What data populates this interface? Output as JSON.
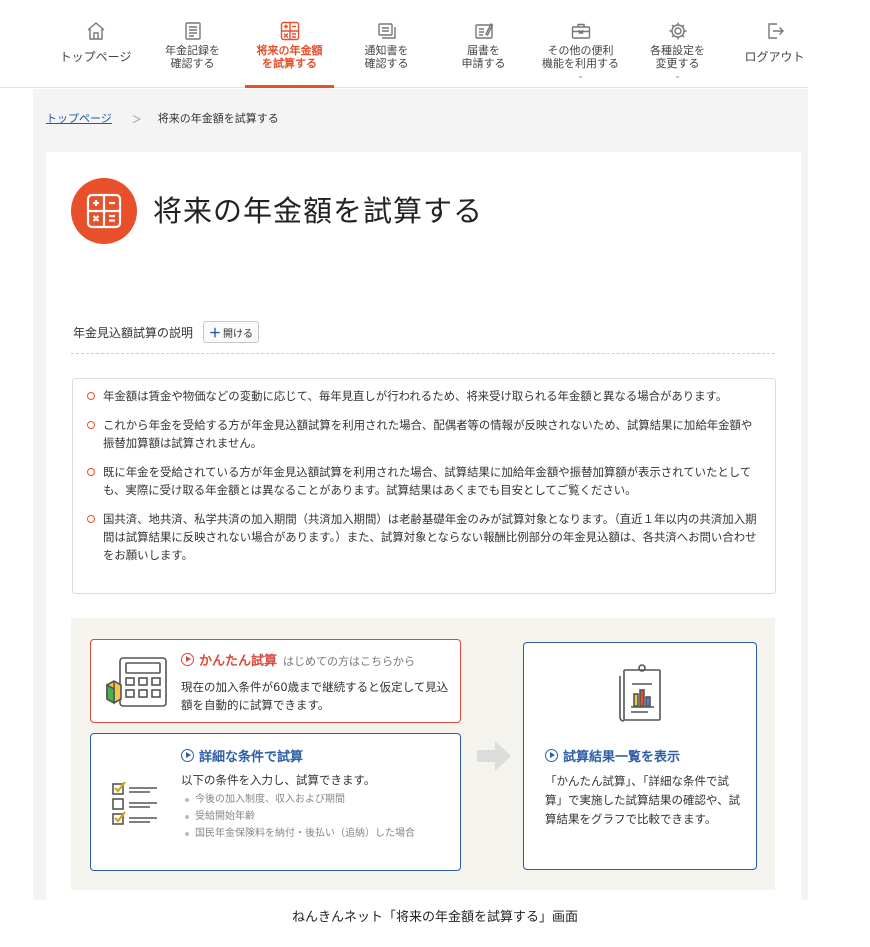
{
  "nav": {
    "items": [
      {
        "label": "トップページ",
        "icon": "home-icon"
      },
      {
        "label": "年金記録を\n確認する",
        "icon": "document-icon"
      },
      {
        "label": "将来の年金額\nを試算する",
        "icon": "calculator-icon",
        "active": true
      },
      {
        "label": "通知書を\n確認する",
        "icon": "notice-icon"
      },
      {
        "label": "届書を\n申請する",
        "icon": "form-icon"
      },
      {
        "label": "その他の便利\n機能を利用する",
        "icon": "toolbox-icon",
        "caret": "⌄"
      },
      {
        "label": "各種設定を\n変更する",
        "icon": "gear-icon",
        "caret": "⌄"
      },
      {
        "label": "ログアウト",
        "icon": "logout-icon"
      }
    ],
    "accent_color": "#e8502c"
  },
  "breadcrumb": {
    "home": "トップページ",
    "separator": "＞",
    "current": "将来の年金額を試算する"
  },
  "page": {
    "title": "将来の年金額を試算する"
  },
  "explanation": {
    "label": "年金見込額試算の説明",
    "open_button": "開ける",
    "open_icon": "＋"
  },
  "notes": [
    "年金額は賃金や物価などの変動に応じて、毎年見直しが行われるため、将来受け取られる年金額と異なる場合があります。",
    "これから年金を受給する方が年金見込額試算を利用された場合、配偶者等の情報が反映されないため、試算結果に加給年金額や振替加算額は試算されません。",
    "既に年金を受給されている方が年金見込額試算を利用された場合、試算結果に加給年金額や振替加算額が表示されていたとしても、実際に受け取る年金額とは異なることがあります。試算結果はあくまでも目安としてご覧ください。",
    "国共済、地共済、私学共済の加入期間（共済加入期間）は老齢基礎年金のみが試算対象となります。（直近１年以内の共済加入期間は試算結果に反映されない場合があります。）また、試算対象とならない報酬比例部分の年金見込額は、各共済へお問い合わせをお願いします。"
  ],
  "easy": {
    "title": "かんたん試算",
    "subtitle": "はじめての方はこちらから",
    "description": "現在の加入条件が60歳まで継続すると仮定して見込額を自動的に試算できます。",
    "color": "#d94a3c"
  },
  "detail": {
    "title": "詳細な条件で試算",
    "description": "以下の条件を入力し、試算できます。",
    "items": [
      "今後の加入制度、収入および期間",
      "受給開始年齢",
      "国民年金保険料を納付・後払い（追納）した場合"
    ],
    "color": "#2e5fa6"
  },
  "result": {
    "title": "試算結果一覧を表示",
    "description": "「かんたん試算」、「詳細な条件で試算」で実施した試算結果の確認や、試算結果をグラフで比較できます。"
  },
  "caption": "ねんきんネット「将来の年金額を試算する」画面"
}
